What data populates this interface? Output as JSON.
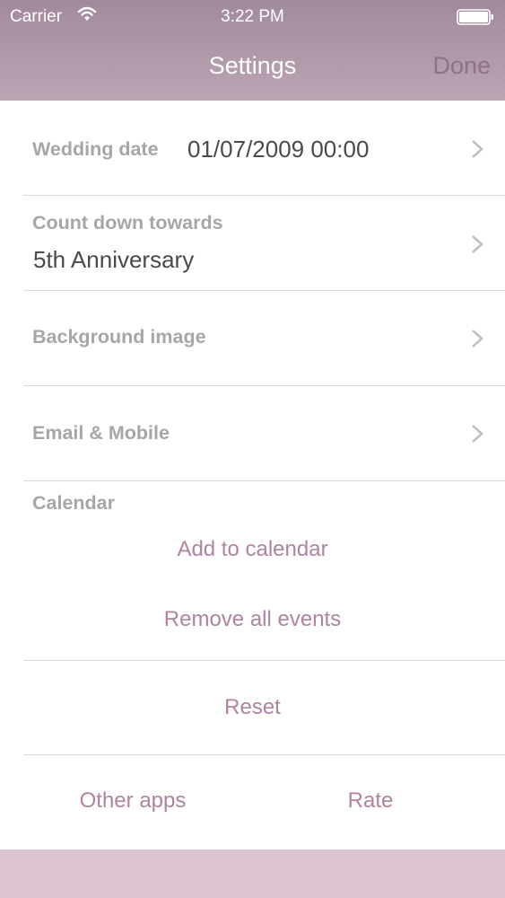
{
  "status": {
    "carrier": "Carrier",
    "time": "3:22 PM"
  },
  "nav": {
    "title": "Settings",
    "done": "Done"
  },
  "settings": {
    "wedding_date_label": "Wedding date",
    "wedding_date_value": "01/07/2009 00:00",
    "countdown_label": "Count down towards",
    "countdown_value": "5th Anniversary",
    "background_label": "Background image",
    "email_label": "Email & Mobile",
    "calendar_label": "Calendar",
    "add_calendar": "Add to calendar",
    "remove_events": "Remove all events",
    "reset": "Reset",
    "other_apps": "Other apps",
    "rate": "Rate"
  },
  "colors": {
    "header": "#a28a9d",
    "accent": "#b0839f",
    "footer": "#dcc3d1"
  },
  "icons": {
    "wifi": "wifi-icon",
    "battery": "battery-icon",
    "chevron": "chevron-right-icon"
  }
}
